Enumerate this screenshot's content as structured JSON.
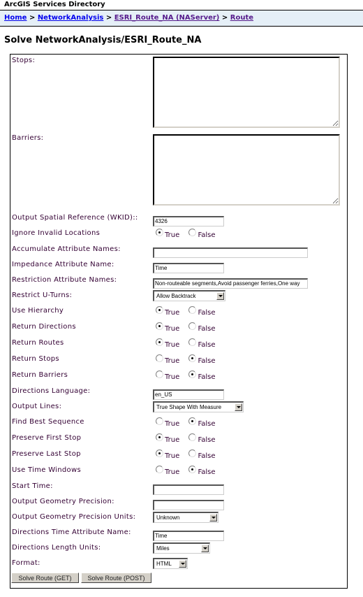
{
  "header": {
    "title": "ArcGIS Services Directory"
  },
  "breadcrumb": {
    "items": [
      {
        "label": "Home"
      },
      {
        "label": "NetworkAnalysis"
      },
      {
        "label": "ESRI_Route_NA (NAServer)"
      },
      {
        "label": "Route"
      }
    ],
    "separator": ">"
  },
  "page_title": "Solve NetworkAnalysis/ESRI_Route_NA",
  "form": {
    "stops": {
      "label": "Stops:",
      "value": ""
    },
    "barriers": {
      "label": "Barriers:",
      "value": ""
    },
    "out_sr": {
      "label": "Output Spatial Reference (WKID)::",
      "value": "4326"
    },
    "ignore_invalid": {
      "label": "Ignore Invalid Locations",
      "selected": "True"
    },
    "accumulate": {
      "label": "Accumulate Attribute Names:",
      "value": ""
    },
    "impedance": {
      "label": "Impedance Attribute Name:",
      "value": "Time"
    },
    "restriction": {
      "label": "Restriction Attribute Names:",
      "value": "Non-routeable segments,Avoid passenger ferries,One way"
    },
    "uturns": {
      "label": "Restrict U-Turns:",
      "value": "Allow Backtrack"
    },
    "hierarchy": {
      "label": "Use Hierarchy",
      "selected": "True"
    },
    "return_directions": {
      "label": "Return Directions",
      "selected": "True"
    },
    "return_routes": {
      "label": "Return Routes",
      "selected": "True"
    },
    "return_stops": {
      "label": "Return Stops",
      "selected": "False"
    },
    "return_barriers": {
      "label": "Return Barriers",
      "selected": "False"
    },
    "directions_language": {
      "label": "Directions Language:",
      "value": "en_US"
    },
    "output_lines": {
      "label": "Output Lines:",
      "value": "True Shape With Measure"
    },
    "find_best_sequence": {
      "label": "Find Best Sequence",
      "selected": "False"
    },
    "preserve_first": {
      "label": "Preserve First Stop",
      "selected": "True"
    },
    "preserve_last": {
      "label": "Preserve Last Stop",
      "selected": "True"
    },
    "time_windows": {
      "label": "Use Time Windows",
      "selected": "False"
    },
    "start_time": {
      "label": "Start Time:",
      "value": ""
    },
    "geom_precision": {
      "label": "Output Geometry Precision:",
      "value": ""
    },
    "geom_precision_units": {
      "label": "Output Geometry Precision Units:",
      "value": "Unknown"
    },
    "dir_time_attr": {
      "label": "Directions Time Attribute Name:",
      "value": "Time"
    },
    "dir_length_units": {
      "label": "Directions Length Units:",
      "value": "Miles"
    },
    "format": {
      "label": "Format:",
      "value": "HTML"
    }
  },
  "radio_labels": {
    "true": "True",
    "false": "False"
  },
  "buttons": {
    "get": "Solve Route (GET)",
    "post": "Solve Route (POST)"
  }
}
